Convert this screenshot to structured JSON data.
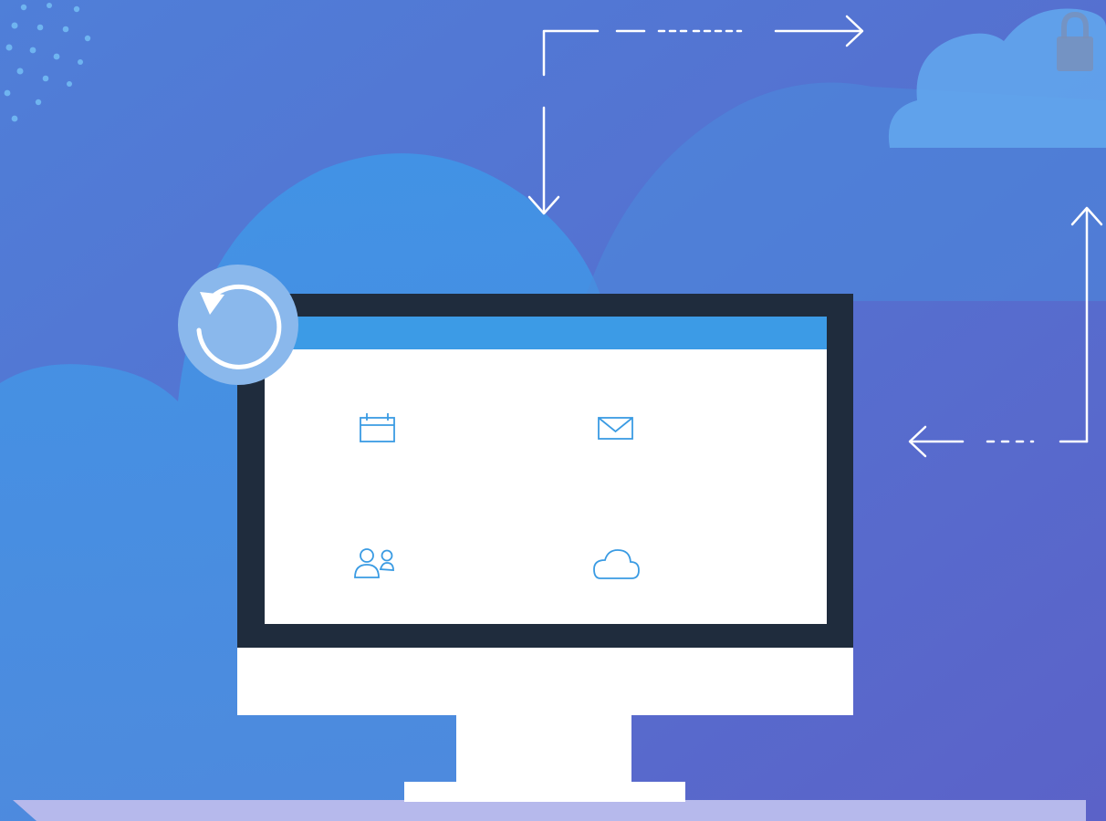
{
  "colors": {
    "background_top": "#4f7fd8",
    "background_bottom": "#5b62c8",
    "cloud_light": "#4aa3ec",
    "cloud_mid": "#3b8fe2",
    "monitor_bezel": "#1f2c3d",
    "monitor_body": "#ffffff",
    "screen_header": "#3c9be6",
    "screen_content": "#ffffff",
    "icon_stroke": "#3a9be3",
    "arrow_stroke": "#ffffff",
    "restore_badge": "#8ab8ec",
    "desk": "#b6b9ec"
  },
  "icons": {
    "restore": "restore-icon",
    "calendar": "calendar-icon",
    "mail": "mail-icon",
    "contacts": "contacts-icon",
    "cloud_storage": "cloud-icon",
    "secure_cloud": "lock-cloud-icon"
  }
}
